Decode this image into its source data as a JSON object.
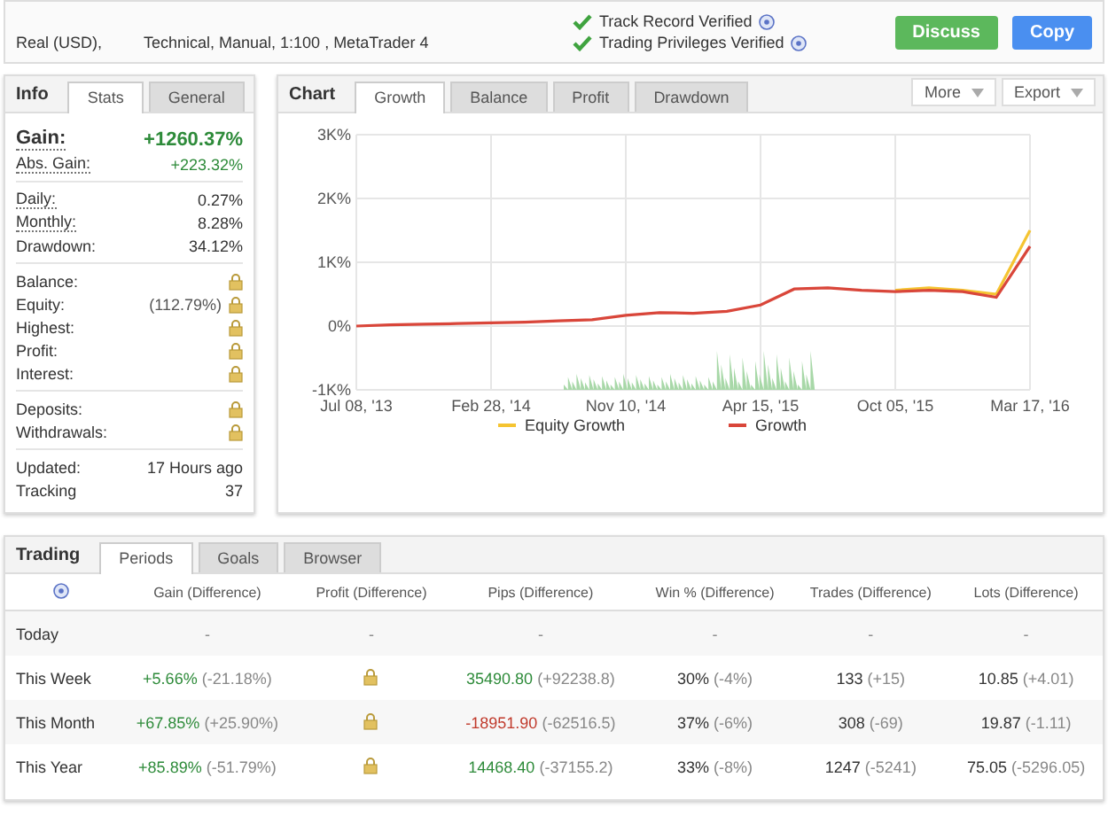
{
  "header": {
    "account": "Real (USD),",
    "system": "Technical, Manual, 1:100 , MetaTrader 4",
    "verifications": [
      {
        "label": "Track Record Verified"
      },
      {
        "label": "Trading Privileges Verified"
      }
    ],
    "buttons": [
      {
        "label": "Discuss",
        "kind": "discuss"
      },
      {
        "label": "Copy",
        "kind": "copy"
      }
    ]
  },
  "info": {
    "title": "Info",
    "tabs": [
      {
        "label": "Stats",
        "selected": true
      },
      {
        "label": "General",
        "selected": false
      }
    ],
    "groups": [
      [
        {
          "label": "Gain:",
          "kind": "text",
          "value": "+1260.37%",
          "color": "#2e8b3a",
          "emphasis": true,
          "dotted": true
        },
        {
          "label": "Abs. Gain:",
          "kind": "text",
          "value": "+223.32%",
          "color": "#2e8b3a",
          "emphasis": false,
          "dotted": true
        }
      ],
      [
        {
          "label": "Daily:",
          "kind": "text",
          "value": "0.27%",
          "color": "#333333",
          "emphasis": false,
          "dotted": true
        },
        {
          "label": "Monthly:",
          "kind": "text",
          "value": "8.28%",
          "color": "#333333",
          "emphasis": false,
          "dotted": true
        },
        {
          "label": "Drawdown:",
          "kind": "text",
          "value": "34.12%",
          "color": "#333333",
          "emphasis": false,
          "dotted": false
        }
      ],
      [
        {
          "label": "Balance:",
          "kind": "locked"
        },
        {
          "label": "Equity:",
          "kind": "locked",
          "note": "(112.79%)"
        },
        {
          "label": "Highest:",
          "kind": "locked"
        },
        {
          "label": "Profit:",
          "kind": "locked"
        },
        {
          "label": "Interest:",
          "kind": "locked"
        }
      ],
      [
        {
          "label": "Deposits:",
          "kind": "locked"
        },
        {
          "label": "Withdrawals:",
          "kind": "locked"
        }
      ],
      [
        {
          "label": "Updated:",
          "kind": "text",
          "value": "17 Hours ago",
          "color": "#333333",
          "emphasis": false,
          "dotted": false
        },
        {
          "label": "Tracking",
          "kind": "text",
          "value": "37",
          "color": "#333333",
          "emphasis": false,
          "dotted": false
        }
      ]
    ]
  },
  "chart": {
    "title": "Chart",
    "tabs": [
      {
        "label": "Growth",
        "selected": true
      },
      {
        "label": "Balance",
        "selected": false
      },
      {
        "label": "Profit",
        "selected": false
      },
      {
        "label": "Drawdown",
        "selected": false
      }
    ],
    "menus": [
      {
        "label": "More"
      },
      {
        "label": "Export"
      }
    ],
    "chart_data": {
      "type": "line",
      "categories": [
        "Jul 08, '13",
        null,
        null,
        null,
        "Feb 28, '14",
        null,
        null,
        null,
        "Nov 10, '14",
        null,
        null,
        null,
        "Apr 15, '15",
        null,
        null,
        null,
        "Oct 05, '15",
        null,
        null,
        null,
        "Mar 17, '16"
      ],
      "series": [
        {
          "name": "Equity Growth",
          "color": "#f5c431",
          "values": [
            null,
            null,
            null,
            null,
            null,
            null,
            null,
            null,
            null,
            null,
            null,
            null,
            null,
            null,
            null,
            null,
            560,
            600,
            560,
            500,
            1500
          ]
        },
        {
          "name": "Growth",
          "color": "#d9463a",
          "values": [
            0,
            20,
            30,
            40,
            50,
            60,
            80,
            100,
            170,
            210,
            200,
            230,
            330,
            580,
            600,
            560,
            540,
            560,
            540,
            450,
            1250
          ]
        }
      ],
      "ylim": [
        -1000,
        3000
      ],
      "grid": true,
      "legend": "bottom",
      "yticks": [
        {
          "value": -1000,
          "label": "-1K%"
        },
        {
          "value": 0,
          "label": "0%"
        },
        {
          "value": 1000,
          "label": "1K%"
        },
        {
          "value": 2000,
          "label": "2K%"
        },
        {
          "value": 3000,
          "label": "3K%"
        }
      ]
    }
  },
  "trading": {
    "title": "Trading",
    "tabs": [
      {
        "label": "Periods",
        "selected": true
      },
      {
        "label": "Goals",
        "selected": false
      },
      {
        "label": "Browser",
        "selected": false
      }
    ],
    "columns": [
      "Gain (Difference)",
      "Profit (Difference)",
      "Pips (Difference)",
      "Win % (Difference)",
      "Trades (Difference)",
      "Lots (Difference)"
    ],
    "rows": [
      {
        "period": "Today",
        "cells": [
          {
            "kind": "text",
            "value": "-",
            "color": "#888888"
          },
          {
            "kind": "text",
            "value": "-",
            "color": "#888888"
          },
          {
            "kind": "text",
            "value": "-",
            "color": "#888888"
          },
          {
            "kind": "text",
            "value": "-",
            "color": "#888888"
          },
          {
            "kind": "text",
            "value": "-",
            "color": "#888888"
          },
          {
            "kind": "text",
            "value": "-",
            "color": "#888888"
          }
        ]
      },
      {
        "period": "This Week",
        "cells": [
          {
            "kind": "text",
            "value": "+5.66%",
            "diff": "(-21.18%)",
            "color": "#2e8b3a"
          },
          {
            "kind": "locked"
          },
          {
            "kind": "text",
            "value": "35490.80",
            "diff": "(+92238.8)",
            "color": "#2e8b3a"
          },
          {
            "kind": "text",
            "value": "30%",
            "diff": "(-4%)",
            "color": "#333333"
          },
          {
            "kind": "text",
            "value": "133",
            "diff": "(+15)",
            "color": "#333333"
          },
          {
            "kind": "text",
            "value": "10.85",
            "diff": "(+4.01)",
            "color": "#333333"
          }
        ]
      },
      {
        "period": "This Month",
        "cells": [
          {
            "kind": "text",
            "value": "+67.85%",
            "diff": "(+25.90%)",
            "color": "#2e8b3a"
          },
          {
            "kind": "locked"
          },
          {
            "kind": "text",
            "value": "-18951.90",
            "diff": "(-62516.5)",
            "color": "#c0392b"
          },
          {
            "kind": "text",
            "value": "37%",
            "diff": "(-6%)",
            "color": "#333333"
          },
          {
            "kind": "text",
            "value": "308",
            "diff": "(-69)",
            "color": "#333333"
          },
          {
            "kind": "text",
            "value": "19.87",
            "diff": "(-1.11)",
            "color": "#333333"
          }
        ]
      },
      {
        "period": "This Year",
        "cells": [
          {
            "kind": "text",
            "value": "+85.89%",
            "diff": "(-51.79%)",
            "color": "#2e8b3a"
          },
          {
            "kind": "locked"
          },
          {
            "kind": "text",
            "value": "14468.40",
            "diff": "(-37155.2)",
            "color": "#2e8b3a"
          },
          {
            "kind": "text",
            "value": "33%",
            "diff": "(-8%)",
            "color": "#333333"
          },
          {
            "kind": "text",
            "value": "1247",
            "diff": "(-5241)",
            "color": "#333333"
          },
          {
            "kind": "text",
            "value": "75.05",
            "diff": "(-5296.05)",
            "color": "#333333"
          }
        ]
      }
    ]
  }
}
